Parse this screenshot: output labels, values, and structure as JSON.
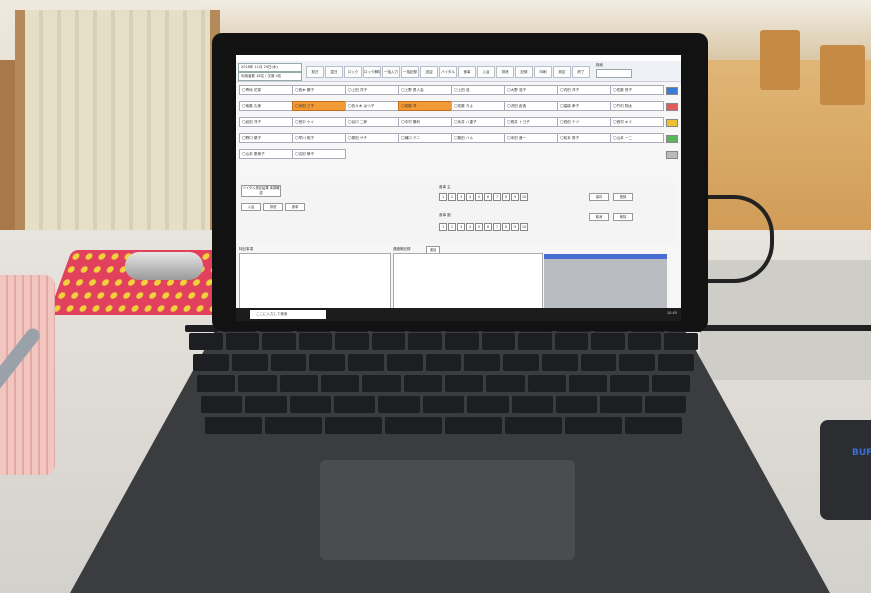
{
  "app": {
    "title": "",
    "toolbar": {
      "date_field": "2018年 11月 29日(木)",
      "sub_field": "利用者数 18名 / 欠席 0名",
      "buttons": [
        "前日",
        "翌日",
        "ロック",
        "ロック解除",
        "一括入力",
        "一括記録",
        "送迎",
        "バイタル",
        "食事",
        "入浴",
        "排泄",
        "記録",
        "印刷",
        "設定",
        "終了"
      ],
      "search_label": "検索",
      "search_value": ""
    },
    "seat_rows": [
      [
        "〇青地 花菜",
        "〇西木 勝子",
        "〇上田 洋子",
        "〇上野 勇人会",
        "〇上田 浩",
        "〇大野 浩子",
        "〇内田 洋子",
        "〇佐藤 恒子"
      ],
      [
        "〇後藤 久美",
        "〇米田 さ子",
        "〇佐々木 はつ子",
        "〇佐藤 洋",
        "〇佐藤 きよ",
        "〇沢田 倉造",
        "〇高橋 孝子",
        "〇竹内 翔太"
      ],
      [
        "〇武田 洋子",
        "〇田中 ケイ",
        "〇谷口 二郎",
        "〇中村 勝利",
        "〇永井 八重子",
        "〇長井 トヨ子",
        "〇西田 テツ",
        "〇西村 キミ"
      ],
      [
        "〇野口 優子",
        "〇早川 昭子",
        "〇原田 サチ",
        "〇樋口 クニ",
        "〇藤田 ハル",
        "〇本田 進一",
        "〇松本 秀子",
        "〇山本 一二"
      ],
      [
        "〇山本 恵美子",
        "〇吉田 静子"
      ]
    ],
    "highlighted": [
      "〇米田 さ子",
      "〇佐藤 洋"
    ],
    "lower_panel": {
      "left_title": "バイタル測定結果 体調確認",
      "buttons_left": [
        "入浴",
        "排泄",
        "食事"
      ],
      "memo_label_left": "特記事項",
      "memo_label_mid": "連絡帳記録",
      "memo_button": "追加",
      "num_labels": [
        "1",
        "2",
        "3",
        "4",
        "5",
        "6",
        "7",
        "8",
        "9",
        "10"
      ],
      "right_buttons": [
        "保存",
        "登録",
        "取消",
        "削除"
      ],
      "meal_label": "食事 主",
      "meal_label2": "食事 副"
    },
    "taskbar": {
      "search_placeholder": "ここに入力して検索",
      "time": "10:45"
    }
  },
  "device_label": "BUF"
}
